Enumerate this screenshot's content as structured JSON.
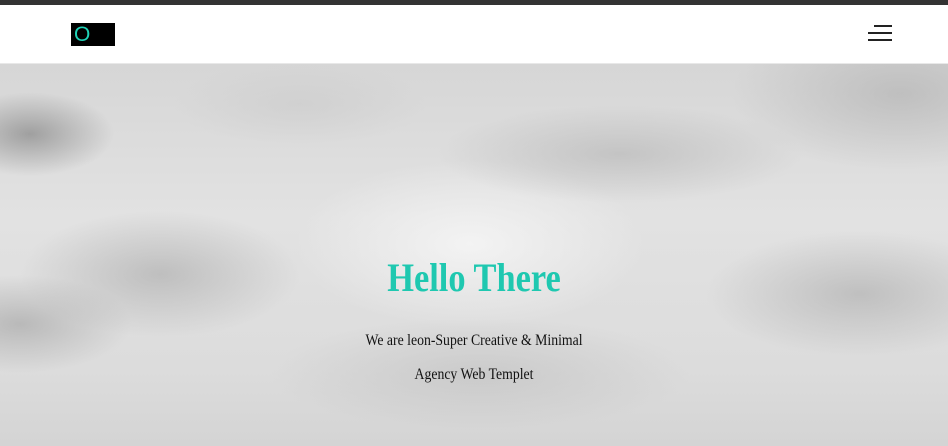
{
  "header": {
    "logo_text": "O",
    "logo_color": "#1fd3b8",
    "menu_icon": "hamburger-menu-icon"
  },
  "hero": {
    "title": "Hello There",
    "subtitle_line1": "We are leon-Super Creative & Minimal",
    "subtitle_line2": "Agency Web Templet",
    "accent_color": "#1fc8b0"
  }
}
